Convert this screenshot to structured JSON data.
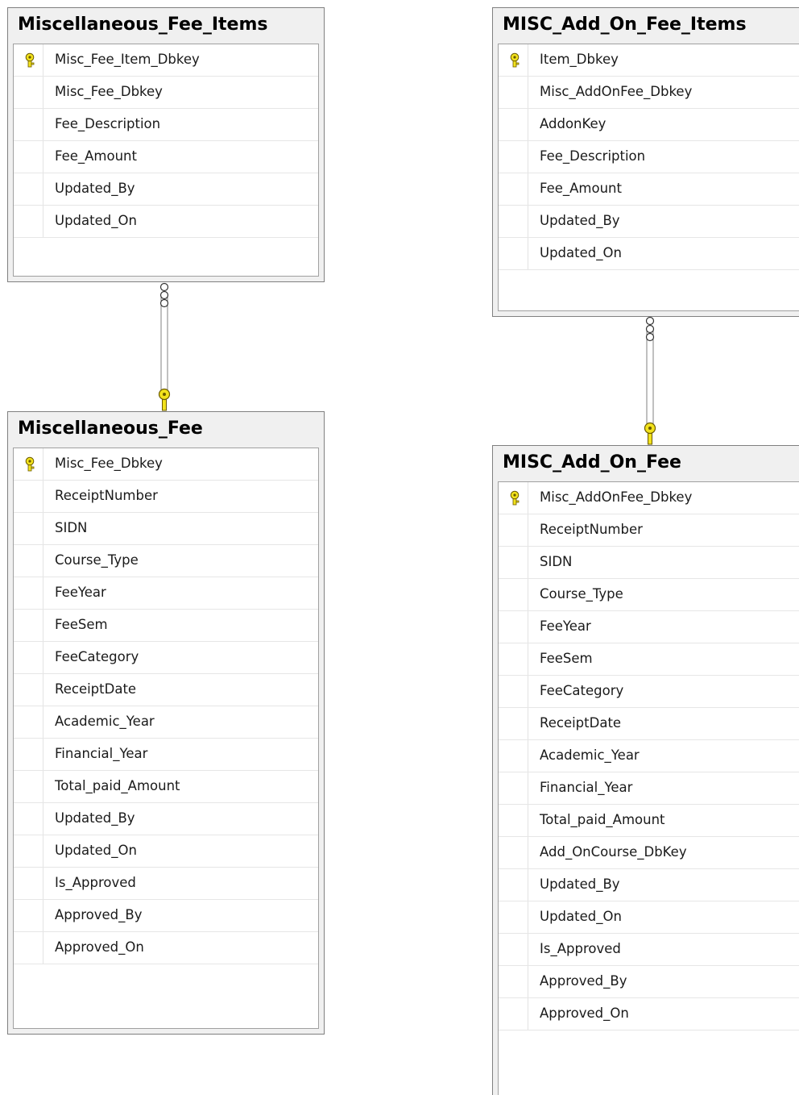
{
  "tables": [
    {
      "id": "miscellaneous-fee-items",
      "title": "Miscellaneous_Fee_Items",
      "columns": [
        {
          "name": "Misc_Fee_Item_Dbkey",
          "key": true
        },
        {
          "name": "Misc_Fee_Dbkey",
          "key": false
        },
        {
          "name": "Fee_Description",
          "key": false
        },
        {
          "name": "Fee_Amount",
          "key": false
        },
        {
          "name": "Updated_By",
          "key": false
        },
        {
          "name": "Updated_On",
          "key": false
        }
      ]
    },
    {
      "id": "misc-add-on-fee-items",
      "title": "MISC_Add_On_Fee_Items",
      "columns": [
        {
          "name": "Item_Dbkey",
          "key": true
        },
        {
          "name": "Misc_AddOnFee_Dbkey",
          "key": false
        },
        {
          "name": "AddonKey",
          "key": false
        },
        {
          "name": "Fee_Description",
          "key": false
        },
        {
          "name": "Fee_Amount",
          "key": false
        },
        {
          "name": "Updated_By",
          "key": false
        },
        {
          "name": "Updated_On",
          "key": false
        }
      ]
    },
    {
      "id": "miscellaneous-fee",
      "title": "Miscellaneous_Fee",
      "columns": [
        {
          "name": "Misc_Fee_Dbkey",
          "key": true
        },
        {
          "name": "ReceiptNumber",
          "key": false
        },
        {
          "name": "SIDN",
          "key": false
        },
        {
          "name": "Course_Type",
          "key": false
        },
        {
          "name": "FeeYear",
          "key": false
        },
        {
          "name": "FeeSem",
          "key": false
        },
        {
          "name": "FeeCategory",
          "key": false
        },
        {
          "name": "ReceiptDate",
          "key": false
        },
        {
          "name": "Academic_Year",
          "key": false
        },
        {
          "name": "Financial_Year",
          "key": false
        },
        {
          "name": "Total_paid_Amount",
          "key": false
        },
        {
          "name": "Updated_By",
          "key": false
        },
        {
          "name": "Updated_On",
          "key": false
        },
        {
          "name": "Is_Approved",
          "key": false
        },
        {
          "name": "Approved_By",
          "key": false
        },
        {
          "name": "Approved_On",
          "key": false
        }
      ]
    },
    {
      "id": "misc-add-on-fee",
      "title": "MISC_Add_On_Fee",
      "columns": [
        {
          "name": "Misc_AddOnFee_Dbkey",
          "key": true
        },
        {
          "name": "ReceiptNumber",
          "key": false
        },
        {
          "name": "SIDN",
          "key": false
        },
        {
          "name": "Course_Type",
          "key": false
        },
        {
          "name": "FeeYear",
          "key": false
        },
        {
          "name": "FeeSem",
          "key": false
        },
        {
          "name": "FeeCategory",
          "key": false
        },
        {
          "name": "ReceiptDate",
          "key": false
        },
        {
          "name": "Academic_Year",
          "key": false
        },
        {
          "name": "Financial_Year",
          "key": false
        },
        {
          "name": "Total_paid_Amount",
          "key": false
        },
        {
          "name": "Add_OnCourse_DbKey",
          "key": false
        },
        {
          "name": "Updated_By",
          "key": false
        },
        {
          "name": "Updated_On",
          "key": false
        },
        {
          "name": "Is_Approved",
          "key": false
        },
        {
          "name": "Approved_By",
          "key": false
        },
        {
          "name": "Approved_On",
          "key": false
        }
      ]
    }
  ],
  "relationships": [
    {
      "from": "miscellaneous-fee-items",
      "to": "miscellaneous-fee",
      "from_end": "many",
      "to_end": "one"
    },
    {
      "from": "misc-add-on-fee-items",
      "to": "misc-add-on-fee",
      "from_end": "many",
      "to_end": "one"
    }
  ],
  "colors": {
    "key_icon": "#f2e21c",
    "key_outline": "#6b5a00",
    "connector": "#808080"
  }
}
